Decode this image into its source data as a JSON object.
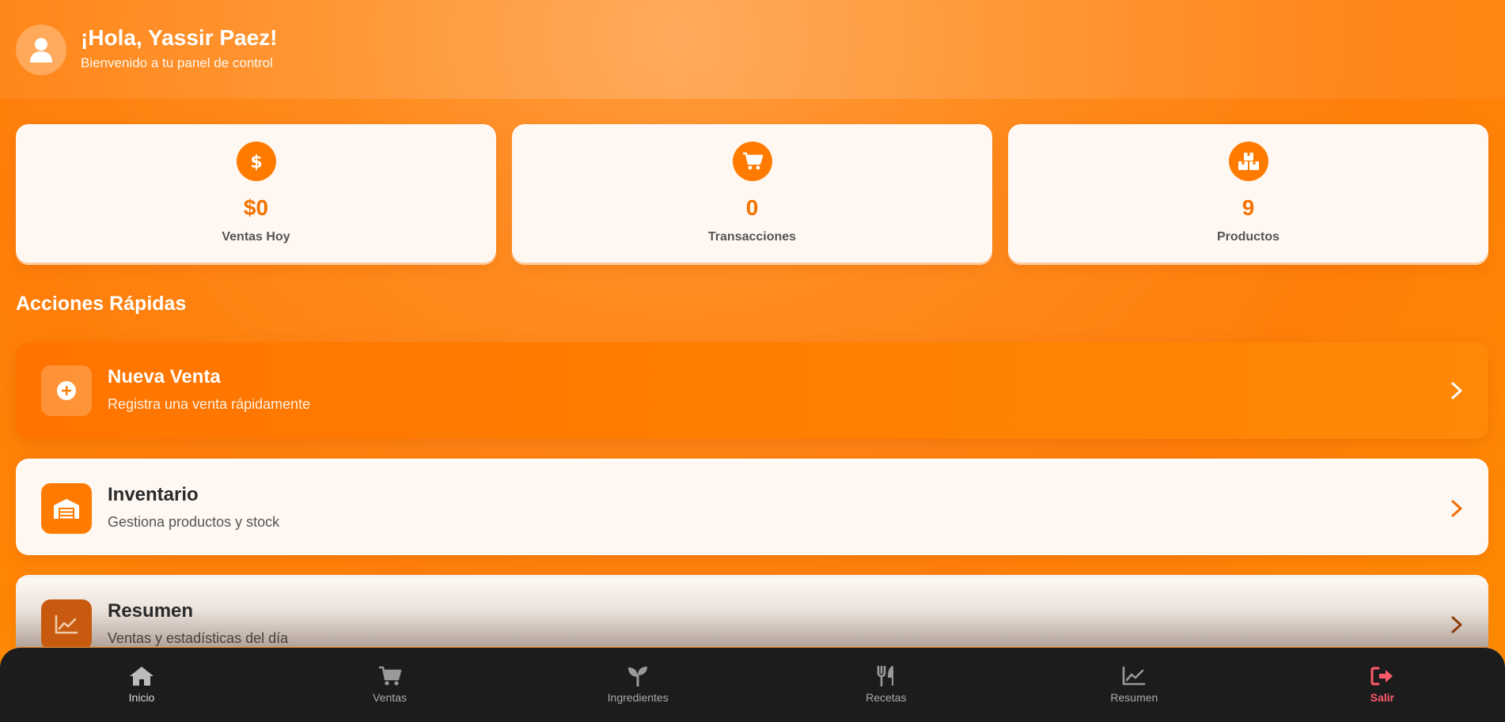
{
  "header": {
    "greeting": "¡Hola, Yassir Paez!",
    "subtitle": "Bienvenido a tu panel de control"
  },
  "stats": [
    {
      "icon": "dollar-icon",
      "value": "$0",
      "label": "Ventas Hoy"
    },
    {
      "icon": "cart-icon",
      "value": "0",
      "label": "Transacciones"
    },
    {
      "icon": "boxes-icon",
      "value": "9",
      "label": "Productos"
    }
  ],
  "section_title": "Acciones Rápidas",
  "actions": [
    {
      "icon": "plus-circle-icon",
      "title": "Nueva Venta",
      "subtitle": "Registra una venta rápidamente"
    },
    {
      "icon": "warehouse-icon",
      "title": "Inventario",
      "subtitle": "Gestiona productos y stock"
    },
    {
      "icon": "chart-line-icon",
      "title": "Resumen",
      "subtitle": "Ventas y estadísticas del día"
    }
  ],
  "nav": [
    {
      "icon": "home-icon",
      "label": "Inicio"
    },
    {
      "icon": "cart-icon",
      "label": "Ventas"
    },
    {
      "icon": "seedling-icon",
      "label": "Ingredientes"
    },
    {
      "icon": "utensils-icon",
      "label": "Recetas"
    },
    {
      "icon": "chart-line-icon",
      "label": "Resumen"
    },
    {
      "icon": "logout-icon",
      "label": "Salir"
    }
  ],
  "colors": {
    "accent": "#ff7b00",
    "nav_background": "#1c1c1c",
    "exit": "#ff5a6a"
  }
}
